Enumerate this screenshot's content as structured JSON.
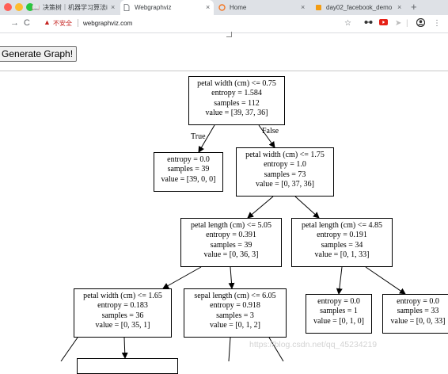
{
  "browser": {
    "tabs": [
      {
        "label": "决策树｜机器学习算法i",
        "icon": "book-icon",
        "active": false
      },
      {
        "label": "Webgraphviz",
        "icon": "page-icon",
        "active": true
      },
      {
        "label": "Home",
        "icon": "jupyter-icon",
        "active": false
      },
      {
        "label": "day02_facebook_demo",
        "icon": "notebook-icon",
        "active": false
      }
    ],
    "close_glyph": "×",
    "new_tab_glyph": "+",
    "security_label": "不安全",
    "url": "webgraphviz.com"
  },
  "page": {
    "generate_button": "Generate Graph!"
  },
  "tree": {
    "nodes": [
      {
        "id": "n0",
        "lines": [
          "petal width (cm) <= 0.75",
          "entropy = 1.584",
          "samples = 112",
          "value = [39, 37, 36]"
        ]
      },
      {
        "id": "n1",
        "lines": [
          "entropy = 0.0",
          "samples = 39",
          "value = [39, 0, 0]"
        ]
      },
      {
        "id": "n2",
        "lines": [
          "petal width (cm) <= 1.75",
          "entropy = 1.0",
          "samples = 73",
          "value = [0, 37, 36]"
        ]
      },
      {
        "id": "n3",
        "lines": [
          "petal length (cm) <= 5.05",
          "entropy = 0.391",
          "samples = 39",
          "value = [0, 36, 3]"
        ]
      },
      {
        "id": "n4",
        "lines": [
          "petal length (cm) <= 4.85",
          "entropy = 0.191",
          "samples = 34",
          "value = [0, 1, 33]"
        ]
      },
      {
        "id": "n5",
        "lines": [
          "petal width (cm) <= 1.65",
          "entropy = 0.183",
          "samples = 36",
          "value = [0, 35, 1]"
        ]
      },
      {
        "id": "n6",
        "lines": [
          "sepal length (cm) <= 6.05",
          "entropy = 0.918",
          "samples = 3",
          "value = [0, 1, 2]"
        ]
      },
      {
        "id": "n7",
        "lines": [
          "entropy = 0.0",
          "samples = 1",
          "value = [0, 1, 0]"
        ]
      },
      {
        "id": "n8",
        "lines": [
          "entropy = 0.0",
          "samples = 33",
          "value = [0, 0, 33]"
        ]
      }
    ],
    "edge_labels": {
      "true_label": "True",
      "false_label": "False"
    }
  },
  "watermark": "https://blog.csdn.net/qq_45234219"
}
